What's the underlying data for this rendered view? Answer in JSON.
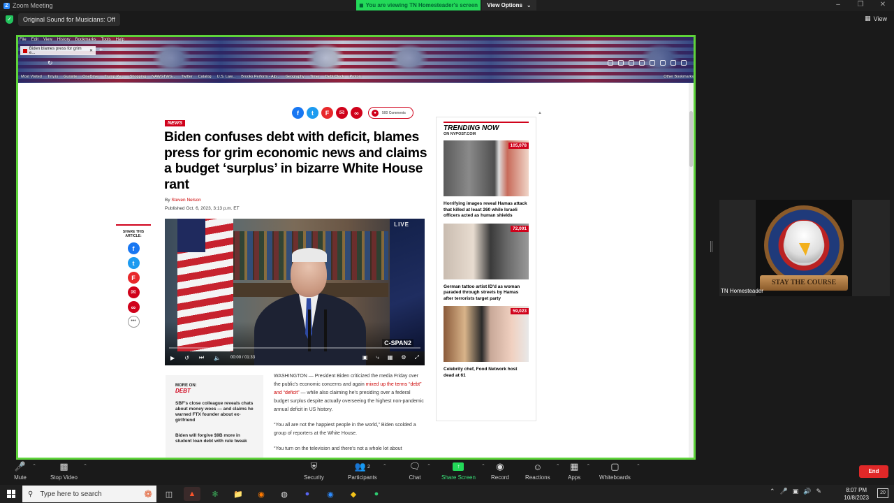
{
  "zoom": {
    "window_title": "Zoom Meeting",
    "viewing_banner": "You are viewing TN Homesteader's screen",
    "view_options": "View Options",
    "original_sound": "Original Sound for Musicians: Off",
    "view_label": "View",
    "participant_name": "TN Homesteader",
    "participant_banner": "STAY THE COURSE",
    "toolbar": {
      "mute": "Mute",
      "stop_video": "Stop Video",
      "security": "Security",
      "participants": "Participants",
      "participants_count": "2",
      "chat": "Chat",
      "share_screen": "Share Screen",
      "record": "Record",
      "reactions": "Reactions",
      "apps": "Apps",
      "whiteboards": "Whiteboards",
      "end": "End"
    },
    "accent_green": "#23d959",
    "end_red": "#e02828"
  },
  "browser": {
    "menu": [
      "File",
      "Edit",
      "View",
      "History",
      "Bookmarks",
      "Tools",
      "Help"
    ],
    "tab_title": "Biden blames press for grim e...",
    "bookmarks": [
      "Most Visited",
      "Tiny.is",
      "Gunsite",
      "OneDrive",
      "Trump Pe...",
      "Shopping",
      "NAWGTWG...",
      "Twitter",
      "Catalog",
      "U.S. Law...",
      "Brooks Perform - Alp...",
      "Geography",
      "Timer",
      "Debt Clock",
      "Proton",
      "Other Bookmarks"
    ]
  },
  "article": {
    "section_badge": "NEWS",
    "headline": "Biden confuses debt with deficit, blames press for grim economic news and claims a budget ‘surplus’ in bizarre White House rant",
    "by_prefix": "By",
    "author": "Steven Nelson",
    "published": "Published Oct. 6, 2023, 3:13 p.m. ET",
    "comments": "500 Comments",
    "share_label": "SHARE THIS ARTICLE:",
    "video": {
      "live": "LIVE",
      "network": "C-SPAN2",
      "time_current": "00:00",
      "time_total": "01:33"
    },
    "more_on": {
      "label": "MORE ON:",
      "topic": "DEBT",
      "stories": [
        "SBF's close colleague reveals chats about money woes — and claims he warned FTX founder about ex-girlfriend",
        "Biden will forgive $9B more in student loan debt with rule tweak"
      ]
    },
    "body": {
      "p1_start": "WASHINGTON — President Biden criticized the media Friday over the public's economic concerns and again ",
      "p1_link": "mixed up the terms “debt” and “deficit”",
      "p1_end": " — while also claiming he's presiding over a federal budget surplus despite actually overseeing the highest non-pandemic annual deficit in US history.",
      "p2": "“You all are not the happiest people in the world,” Biden scolded a group of reporters at the White House.",
      "p3": "“You turn on the television and there's not a whole lot about"
    }
  },
  "trending": {
    "title": "TRENDING NOW",
    "subtitle": "ON NYPOST.COM",
    "items": [
      {
        "count": "105,078",
        "caption": "Horrifying images reveal Hamas attack that killed at least 260 while Israeli officers acted as human shields"
      },
      {
        "count": "72,001",
        "caption": "German tattoo artist ID'd as woman paraded through streets by Hamas after terrorists target party"
      },
      {
        "count": "59,023",
        "caption": "Celebrity chef, Food Network host dead at 61"
      }
    ]
  },
  "taskbar": {
    "search_placeholder": "Type here to search",
    "time": "8:07 PM",
    "date": "10/8/2023",
    "notifications": "20"
  }
}
